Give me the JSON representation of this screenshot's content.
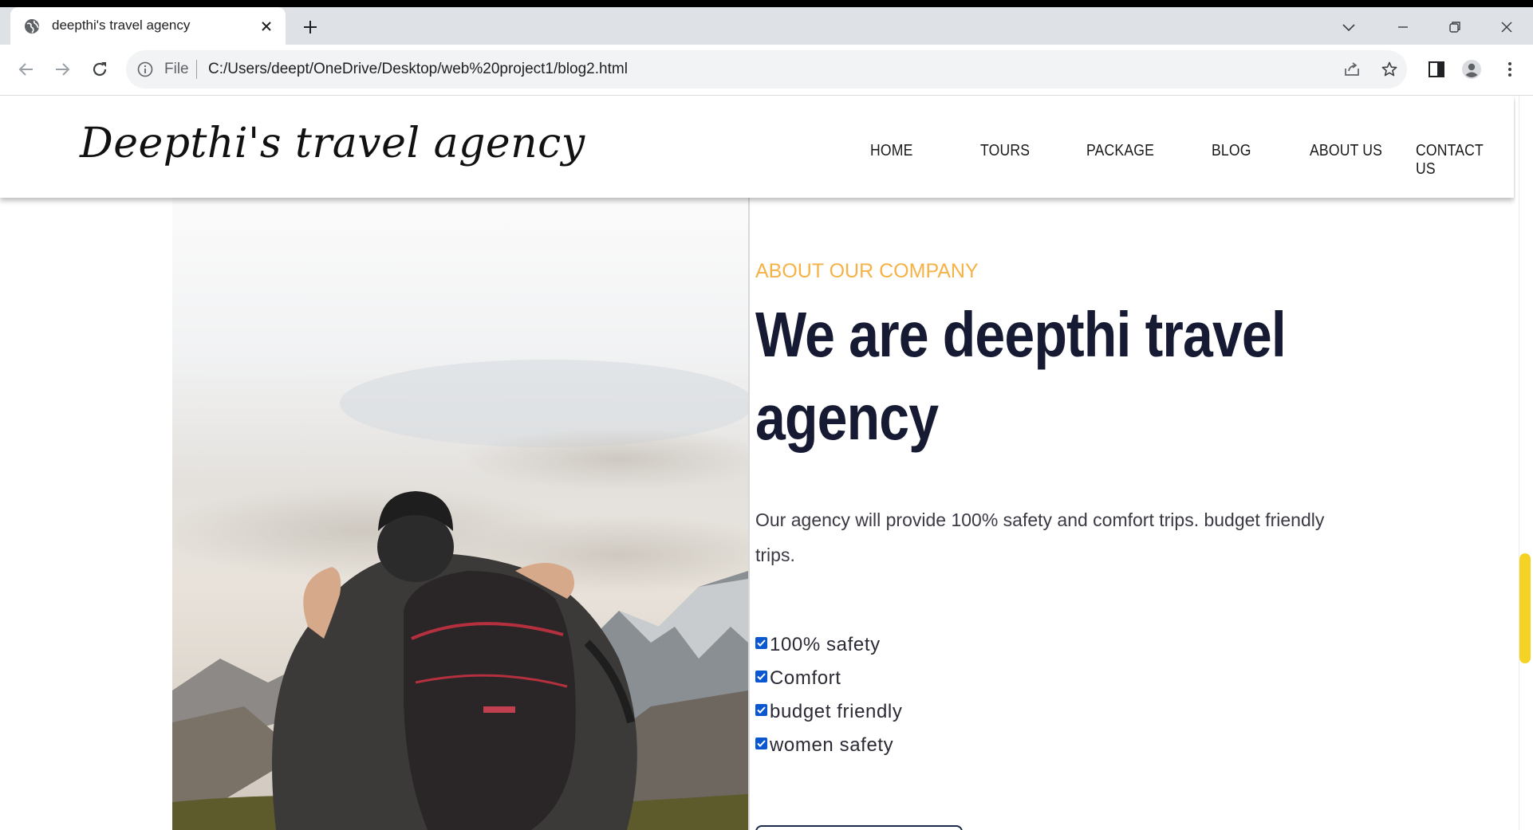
{
  "browser": {
    "tab": {
      "title": "deepthi's travel agency",
      "favicon": "globe-icon"
    },
    "address": {
      "scheme_label": "File",
      "url": "C:/Users/deept/OneDrive/Desktop/web%20project1/blog2.html"
    }
  },
  "site": {
    "logo": "Deepthi's travel agency",
    "nav": [
      "HOME",
      "TOURS",
      "PACKAGE",
      "BLOG",
      "ABOUT US",
      "CONTACT US"
    ]
  },
  "about": {
    "eyebrow": "ABOUT OUR COMPANY",
    "headline": "We are deepthi travel agency",
    "description": "Our agency will provide 100% safety and comfort trips. budget friendly trips.",
    "features": [
      "100% safety",
      "Comfort",
      "budget friendly",
      "women safety"
    ]
  },
  "colors": {
    "accent": "#f6b246",
    "headline": "#161a33",
    "checkbox": "#0b57d0",
    "scrollbar_thumb": "#f5d324"
  }
}
